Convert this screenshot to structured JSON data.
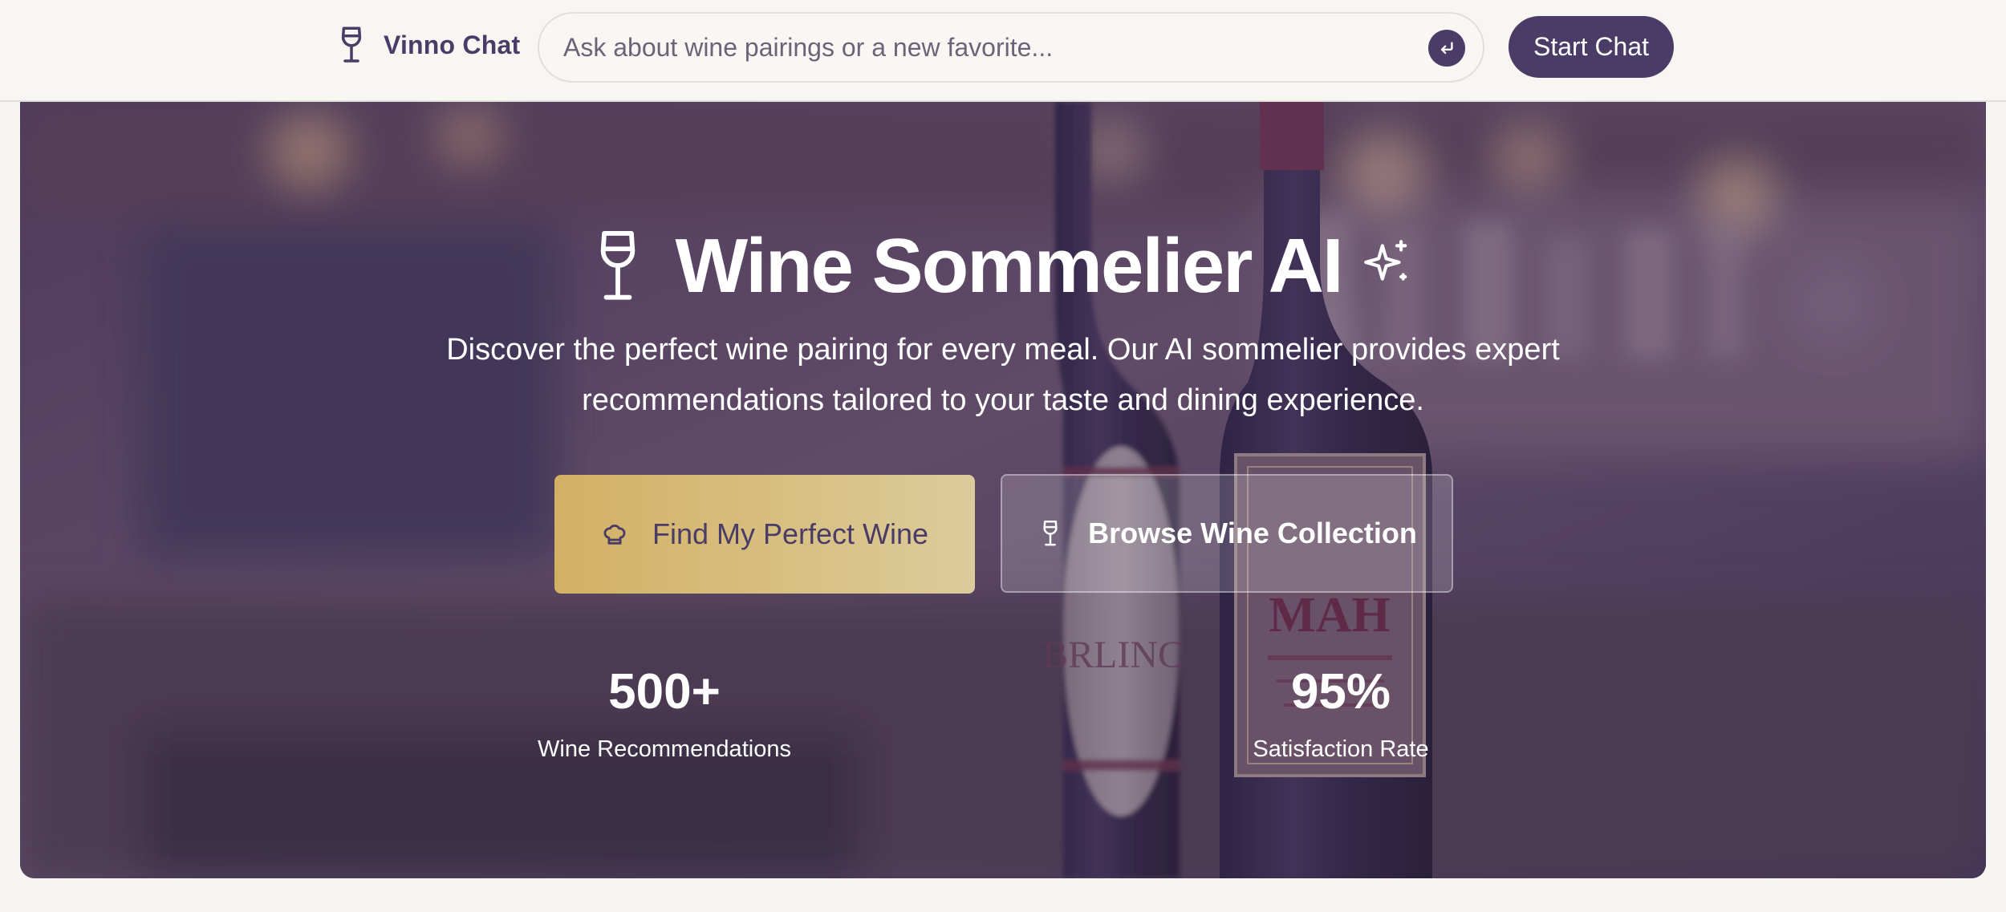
{
  "header": {
    "brand_name": "Vinno Chat",
    "search_placeholder": "Ask about wine pairings or a new favorite...",
    "start_chat_label": "Start Chat",
    "icons": {
      "brand": "wine-glass-icon",
      "submit": "return-arrow-icon"
    }
  },
  "hero": {
    "title": "Wine Sommelier AI",
    "description": "Discover the perfect wine pairing for every meal. Our AI sommelier provides expert recommendations tailored to your taste and dining experience.",
    "primary_cta": "Find My Perfect Wine",
    "secondary_cta": "Browse Wine Collection",
    "stats": [
      {
        "value": "500+",
        "label": "Wine Recommendations"
      },
      {
        "value": "95%",
        "label": "Satisfaction Rate"
      }
    ],
    "bottle_label_text": "BRLINC",
    "bottle_label_text_2": "MAH",
    "icons": {
      "title_left": "wine-glass-icon",
      "title_right": "sparkles-icon",
      "primary_cta": "chef-hat-icon",
      "secondary_cta": "wine-glass-icon"
    }
  },
  "colors": {
    "brand_purple": "#4a3c67",
    "page_background": "#f6f5f1",
    "gold_start": "#d2b163",
    "gold_end": "#dccb9b"
  }
}
